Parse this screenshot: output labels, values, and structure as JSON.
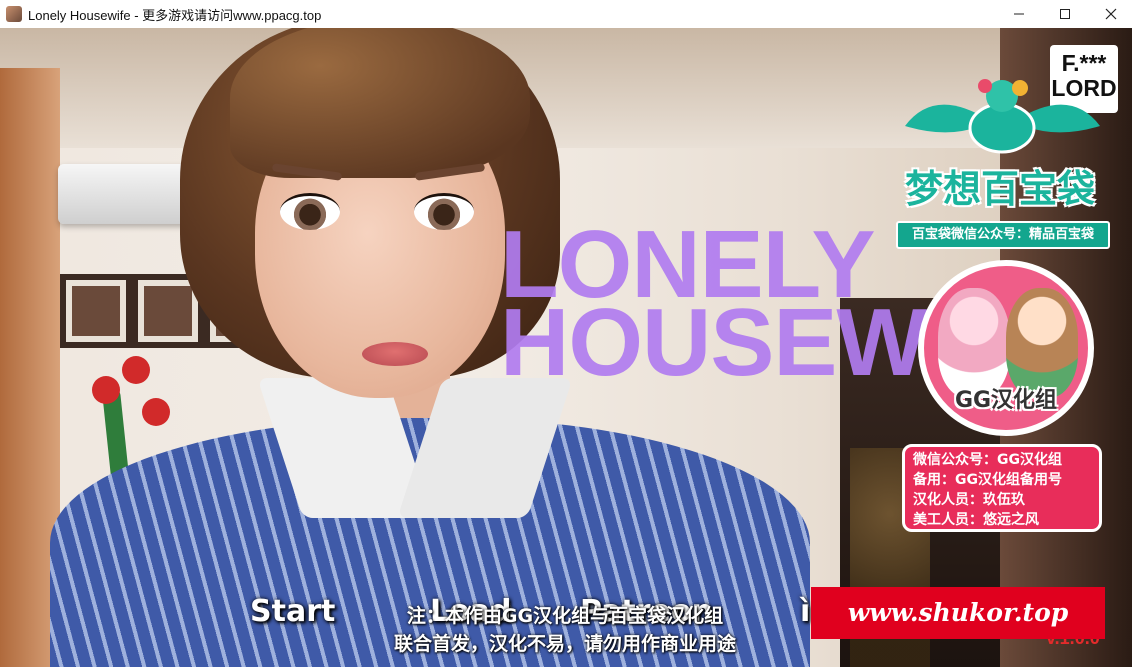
{
  "window": {
    "title": "Lonely Housewife - 更多游戏请访问www.ppacg.top",
    "icon": "app-portrait-icon",
    "controls": [
      "minimize-icon",
      "maximize-icon",
      "close-icon"
    ]
  },
  "game": {
    "title_line1": "LONELY",
    "title_line2": "HOUSEW...",
    "title_color": "#b17cf0"
  },
  "menu": {
    "start": "Start",
    "load": "Load",
    "patreon": "Patreon",
    "extra": "ì",
    "version": "v.1.0.0"
  },
  "watermark_dream": {
    "badge": "F.***\nLORD",
    "name": "梦想百宝袋",
    "wechat_banner": "百宝袋微信公众号：精品百宝袋"
  },
  "gg_group": {
    "circle_label": "GG汉化组",
    "info_lines": [
      "微信公众号：GG汉化组",
      "备用：GG汉化组备用号",
      "汉化人员：玖伍玖",
      "美工人员：悠远之风"
    ]
  },
  "notice": {
    "line1": "注：本作由GG汉化组与百宝袋汉化组",
    "line2": "联合首发，汉化不易，请勿用作商业用途"
  },
  "site_banner": "www.shukor.top",
  "colors": {
    "site_banner_bg": "#e0001e",
    "dream_teal": "#1bb49d",
    "gg_pink": "#ef5d88",
    "gg_info_red": "#e82d5a"
  }
}
